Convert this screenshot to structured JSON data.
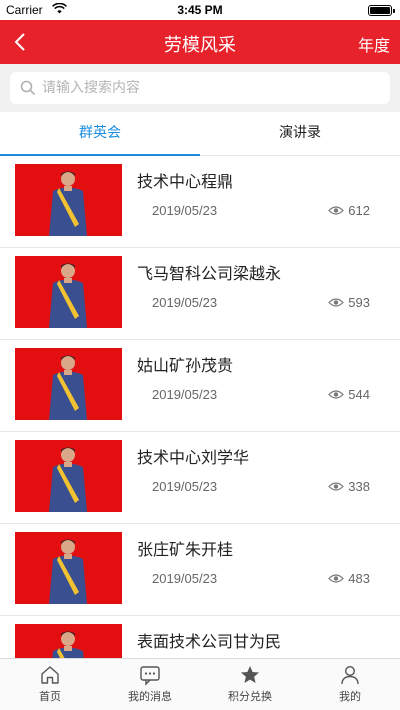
{
  "status_bar": {
    "carrier": "Carrier",
    "time": "3:45 PM"
  },
  "nav": {
    "title": "劳模风采",
    "right_label": "年度"
  },
  "search": {
    "placeholder": "请输入搜索内容",
    "value": ""
  },
  "tabs": [
    {
      "label": "群英会",
      "active": true
    },
    {
      "label": "演讲录",
      "active": false
    }
  ],
  "items": [
    {
      "name": "技术中心程鼎",
      "date": "2019/05/23",
      "views": "612"
    },
    {
      "name": "飞马智科公司梁越永",
      "date": "2019/05/23",
      "views": "593"
    },
    {
      "name": "姑山矿孙茂贵",
      "date": "2019/05/23",
      "views": "544"
    },
    {
      "name": "技术中心刘学华",
      "date": "2019/05/23",
      "views": "338"
    },
    {
      "name": "张庄矿朱开桂",
      "date": "2019/05/23",
      "views": "483"
    },
    {
      "name": "表面技术公司甘为民",
      "date": "",
      "views": ""
    }
  ],
  "tabbar": [
    {
      "label": "首页",
      "icon": "home-icon"
    },
    {
      "label": "我的消息",
      "icon": "message-icon"
    },
    {
      "label": "积分兑换",
      "icon": "star-icon"
    },
    {
      "label": "我的",
      "icon": "user-icon"
    }
  ],
  "colors": {
    "brand": "#e7222b",
    "accent": "#1c8de0",
    "thumb_bg": "#e30e10"
  }
}
